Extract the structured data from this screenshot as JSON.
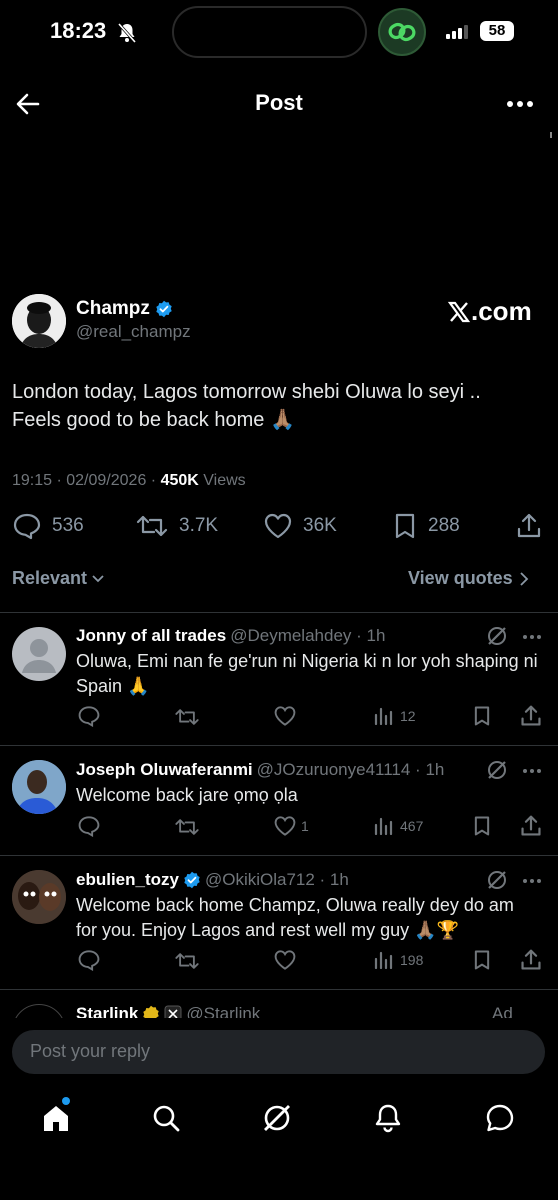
{
  "status_bar": {
    "time": "18:23",
    "battery": "58"
  },
  "header": {
    "title": "Post"
  },
  "post": {
    "author_name": "Champz",
    "handle": "@real_champz",
    "source": ".com",
    "text_line1": "London today, Lagos tomorrow shebi Oluwa lo seyi ..",
    "text_line2": "Feels good to be back home 🙏🏽",
    "time": "19:15 · 02/09/2026 · ",
    "views_count": "450K",
    "views_label": " Views",
    "replies": "536",
    "reposts": "3.7K",
    "likes": "36K",
    "bookmarks": "288"
  },
  "sort": {
    "label": "Relevant",
    "view_quotes": "View quotes"
  },
  "replies": [
    {
      "name": "Jonny of all trades",
      "handle_time": "@Deymelahdey · 1h",
      "text": "Oluwa, Emi nan fe ge'run ni Nigeria ki n lor yoh shaping ni Spain 🙏",
      "views": "12",
      "likes": ""
    },
    {
      "name": "Joseph Oluwaferanmi",
      "handle_time": "@JOzuruonye41114 · 1h",
      "text": "Welcome back jare ọmọ ọla",
      "views": "467",
      "likes": "1"
    },
    {
      "name": "ebulien_tozy",
      "handle_time": "@OkikiOla712 · 1h",
      "text": "Welcome back home Champz, Oluwa really dey do am for you. Enjoy Lagos and rest well my guy 🙏🏽🏆",
      "views": "198",
      "likes": ""
    },
    {
      "name": "Starlink",
      "handle_time": "@Starlink",
      "ad": "Ad"
    }
  ],
  "reply_box": {
    "placeholder": "Post your reply"
  },
  "colors": {
    "background": "#000000",
    "verified": "#1d9bf0",
    "muted": "#71767b"
  }
}
